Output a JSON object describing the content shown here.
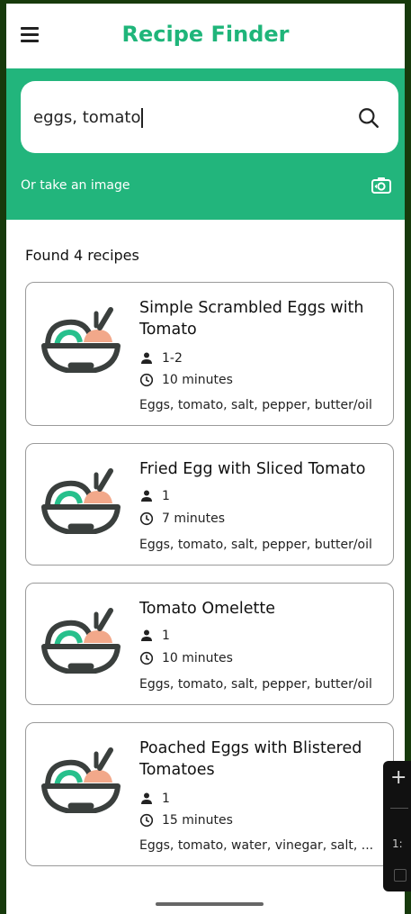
{
  "app": {
    "title": "Recipe Finder"
  },
  "search": {
    "value": "eggs, tomato",
    "image_link": "Or take an image"
  },
  "results": {
    "summary": "Found 4 recipes",
    "recipes": [
      {
        "title": "Simple Scrambled Eggs with Tomato",
        "servings": "1-2",
        "time": "10 minutes",
        "ingredients": "Eggs, tomato, salt, pepper, butter/oil"
      },
      {
        "title": "Fried Egg with Sliced Tomato",
        "servings": "1",
        "time": "7 minutes",
        "ingredients": "Eggs, tomato, salt, pepper, butter/oil"
      },
      {
        "title": "Tomato Omelette",
        "servings": "1",
        "time": "10 minutes",
        "ingredients": "Eggs, tomato, salt, pepper, butter/oil"
      },
      {
        "title": "Poached Eggs with Blistered Tomatoes",
        "servings": "1",
        "time": "15 minutes",
        "ingredients": "Eggs, tomato, water, vinegar, salt, ..."
      }
    ]
  },
  "floating_control": {
    "label": "1:"
  },
  "colors": {
    "brand": "#22b57c",
    "title": "#1fb57a",
    "bowl": "#3a3f3d",
    "accent_green": "#27c08c",
    "accent_peach": "#f2a88a"
  },
  "icons": {
    "menu": "menu-icon",
    "search": "search-icon",
    "camera": "camera-switch-icon",
    "person": "person-icon",
    "clock": "clock-icon",
    "bowl": "bowl-icon"
  }
}
